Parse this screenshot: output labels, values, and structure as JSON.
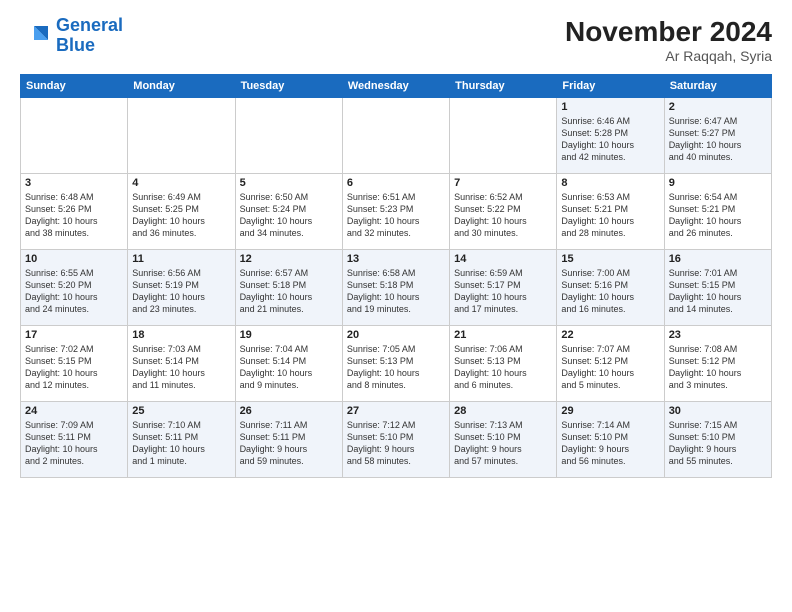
{
  "logo": {
    "line1": "General",
    "line2": "Blue"
  },
  "title": "November 2024",
  "subtitle": "Ar Raqqah, Syria",
  "days_of_week": [
    "Sunday",
    "Monday",
    "Tuesday",
    "Wednesday",
    "Thursday",
    "Friday",
    "Saturday"
  ],
  "weeks": [
    [
      {
        "day": "",
        "info": ""
      },
      {
        "day": "",
        "info": ""
      },
      {
        "day": "",
        "info": ""
      },
      {
        "day": "",
        "info": ""
      },
      {
        "day": "",
        "info": ""
      },
      {
        "day": "1",
        "info": "Sunrise: 6:46 AM\nSunset: 5:28 PM\nDaylight: 10 hours\nand 42 minutes."
      },
      {
        "day": "2",
        "info": "Sunrise: 6:47 AM\nSunset: 5:27 PM\nDaylight: 10 hours\nand 40 minutes."
      }
    ],
    [
      {
        "day": "3",
        "info": "Sunrise: 6:48 AM\nSunset: 5:26 PM\nDaylight: 10 hours\nand 38 minutes."
      },
      {
        "day": "4",
        "info": "Sunrise: 6:49 AM\nSunset: 5:25 PM\nDaylight: 10 hours\nand 36 minutes."
      },
      {
        "day": "5",
        "info": "Sunrise: 6:50 AM\nSunset: 5:24 PM\nDaylight: 10 hours\nand 34 minutes."
      },
      {
        "day": "6",
        "info": "Sunrise: 6:51 AM\nSunset: 5:23 PM\nDaylight: 10 hours\nand 32 minutes."
      },
      {
        "day": "7",
        "info": "Sunrise: 6:52 AM\nSunset: 5:22 PM\nDaylight: 10 hours\nand 30 minutes."
      },
      {
        "day": "8",
        "info": "Sunrise: 6:53 AM\nSunset: 5:21 PM\nDaylight: 10 hours\nand 28 minutes."
      },
      {
        "day": "9",
        "info": "Sunrise: 6:54 AM\nSunset: 5:21 PM\nDaylight: 10 hours\nand 26 minutes."
      }
    ],
    [
      {
        "day": "10",
        "info": "Sunrise: 6:55 AM\nSunset: 5:20 PM\nDaylight: 10 hours\nand 24 minutes."
      },
      {
        "day": "11",
        "info": "Sunrise: 6:56 AM\nSunset: 5:19 PM\nDaylight: 10 hours\nand 23 minutes."
      },
      {
        "day": "12",
        "info": "Sunrise: 6:57 AM\nSunset: 5:18 PM\nDaylight: 10 hours\nand 21 minutes."
      },
      {
        "day": "13",
        "info": "Sunrise: 6:58 AM\nSunset: 5:18 PM\nDaylight: 10 hours\nand 19 minutes."
      },
      {
        "day": "14",
        "info": "Sunrise: 6:59 AM\nSunset: 5:17 PM\nDaylight: 10 hours\nand 17 minutes."
      },
      {
        "day": "15",
        "info": "Sunrise: 7:00 AM\nSunset: 5:16 PM\nDaylight: 10 hours\nand 16 minutes."
      },
      {
        "day": "16",
        "info": "Sunrise: 7:01 AM\nSunset: 5:15 PM\nDaylight: 10 hours\nand 14 minutes."
      }
    ],
    [
      {
        "day": "17",
        "info": "Sunrise: 7:02 AM\nSunset: 5:15 PM\nDaylight: 10 hours\nand 12 minutes."
      },
      {
        "day": "18",
        "info": "Sunrise: 7:03 AM\nSunset: 5:14 PM\nDaylight: 10 hours\nand 11 minutes."
      },
      {
        "day": "19",
        "info": "Sunrise: 7:04 AM\nSunset: 5:14 PM\nDaylight: 10 hours\nand 9 minutes."
      },
      {
        "day": "20",
        "info": "Sunrise: 7:05 AM\nSunset: 5:13 PM\nDaylight: 10 hours\nand 8 minutes."
      },
      {
        "day": "21",
        "info": "Sunrise: 7:06 AM\nSunset: 5:13 PM\nDaylight: 10 hours\nand 6 minutes."
      },
      {
        "day": "22",
        "info": "Sunrise: 7:07 AM\nSunset: 5:12 PM\nDaylight: 10 hours\nand 5 minutes."
      },
      {
        "day": "23",
        "info": "Sunrise: 7:08 AM\nSunset: 5:12 PM\nDaylight: 10 hours\nand 3 minutes."
      }
    ],
    [
      {
        "day": "24",
        "info": "Sunrise: 7:09 AM\nSunset: 5:11 PM\nDaylight: 10 hours\nand 2 minutes."
      },
      {
        "day": "25",
        "info": "Sunrise: 7:10 AM\nSunset: 5:11 PM\nDaylight: 10 hours\nand 1 minute."
      },
      {
        "day": "26",
        "info": "Sunrise: 7:11 AM\nSunset: 5:11 PM\nDaylight: 9 hours\nand 59 minutes."
      },
      {
        "day": "27",
        "info": "Sunrise: 7:12 AM\nSunset: 5:10 PM\nDaylight: 9 hours\nand 58 minutes."
      },
      {
        "day": "28",
        "info": "Sunrise: 7:13 AM\nSunset: 5:10 PM\nDaylight: 9 hours\nand 57 minutes."
      },
      {
        "day": "29",
        "info": "Sunrise: 7:14 AM\nSunset: 5:10 PM\nDaylight: 9 hours\nand 56 minutes."
      },
      {
        "day": "30",
        "info": "Sunrise: 7:15 AM\nSunset: 5:10 PM\nDaylight: 9 hours\nand 55 minutes."
      }
    ]
  ]
}
